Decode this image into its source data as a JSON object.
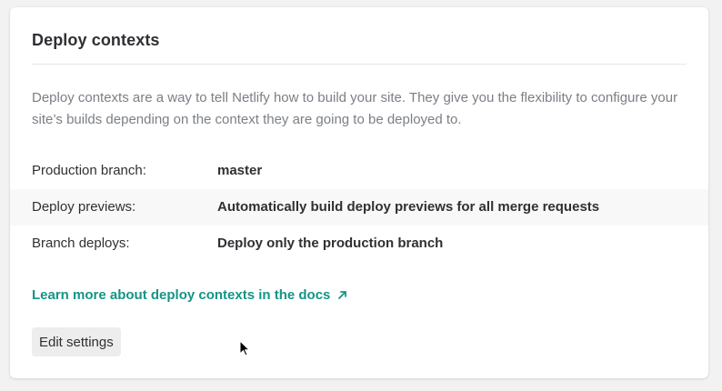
{
  "panel": {
    "title": "Deploy contexts",
    "description": "Deploy contexts are a way to tell Netlify how to build your site. They give you the flexibility to configure your site’s builds depending on the context they are going to be deployed to."
  },
  "settings": [
    {
      "label": "Production branch:",
      "value": "master"
    },
    {
      "label": "Deploy previews:",
      "value": "Automatically build deploy previews for all merge requests"
    },
    {
      "label": "Branch deploys:",
      "value": "Deploy only the production branch"
    }
  ],
  "docs_link": {
    "text": "Learn more about deploy contexts in the docs",
    "icon": "external-arrow-icon"
  },
  "actions": {
    "edit_label": "Edit settings"
  },
  "colors": {
    "link": "#149585",
    "text": "#2e3033",
    "muted": "#7b7f85"
  }
}
